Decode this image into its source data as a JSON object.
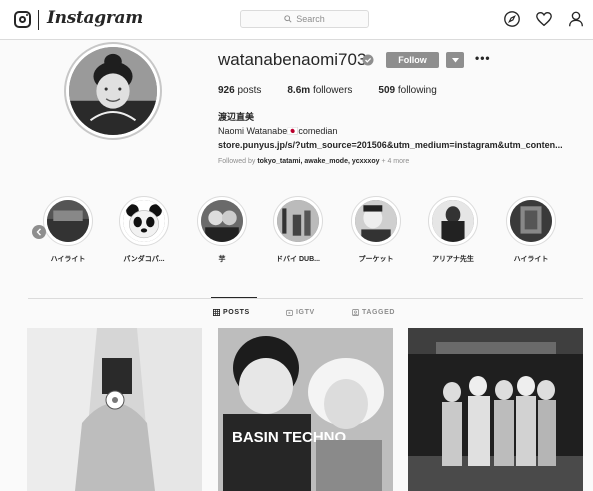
{
  "app": {
    "brand": "Instagram"
  },
  "search": {
    "placeholder": "Search"
  },
  "profile": {
    "username": "watanabenaomi703",
    "follow_label": "Follow",
    "more_label": "•••",
    "stats": {
      "posts_count": "926",
      "posts_label": "posts",
      "followers_count": "8.6m",
      "followers_label": "followers",
      "following_count": "509",
      "following_label": "following"
    },
    "bio": {
      "name": "渡辺直美",
      "line1": "Naomi Watanabe🇯🇵comedian",
      "link": "store.punyus.jp/s/?utm_source=201506&utm_medium=instagram&utm_conten..."
    },
    "followed_by": {
      "prefix": "Followed by",
      "users": "tokyo_tatami, awake_mode, ycxxxoy",
      "suffix": "+ 4 more"
    }
  },
  "highlights": [
    {
      "label": "ハイライト"
    },
    {
      "label": "パンダコパ..."
    },
    {
      "label": "芋"
    },
    {
      "label": "ドバイ DUB..."
    },
    {
      "label": "プーケット"
    },
    {
      "label": "アリアナ先生"
    },
    {
      "label": "ハイライト"
    }
  ],
  "tabs": [
    {
      "label": "POSTS",
      "icon": "grid-icon",
      "active": true
    },
    {
      "label": "IGTV",
      "icon": "igtv-icon",
      "active": false
    },
    {
      "label": "TAGGED",
      "icon": "tag-icon",
      "active": false
    }
  ],
  "posts": [
    {
      "caption": "",
      "overlay_text": ""
    },
    {
      "caption": "",
      "overlay_text": "BASIN TECHNO"
    },
    {
      "caption": "",
      "overlay_text": ""
    }
  ],
  "colors": {
    "text": "#262626",
    "muted": "#8e8e8e",
    "border": "#dbdbdb",
    "button": "#8e8e8e",
    "background": "#fafafa"
  }
}
